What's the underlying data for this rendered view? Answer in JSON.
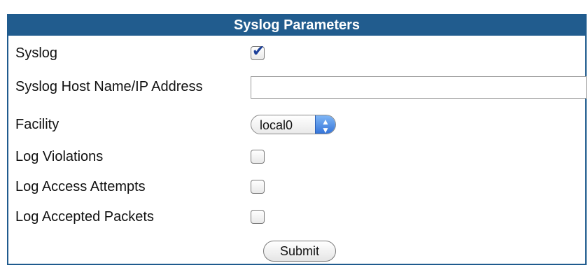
{
  "header": {
    "title": "Syslog Parameters"
  },
  "form": {
    "syslog": {
      "label": "Syslog",
      "checked": true
    },
    "host": {
      "label": "Syslog Host Name/IP Address",
      "value": "",
      "placeholder": ""
    },
    "facility": {
      "label": "Facility",
      "selected": "local0"
    },
    "log_violations": {
      "label": "Log Violations",
      "checked": false
    },
    "log_access_attempts": {
      "label": "Log Access Attempts",
      "checked": false
    },
    "log_accepted_packets": {
      "label": "Log Accepted Packets",
      "checked": false
    },
    "submit_label": "Submit"
  },
  "icons": {
    "checkmark": "checkmark-icon",
    "select_arrows": "up-down-arrows-icon"
  },
  "colors": {
    "header_bg": "#215c8e",
    "border": "#1f5b8e",
    "checkmark": "#1b3f99",
    "select_accent": "#2f6fd6"
  }
}
